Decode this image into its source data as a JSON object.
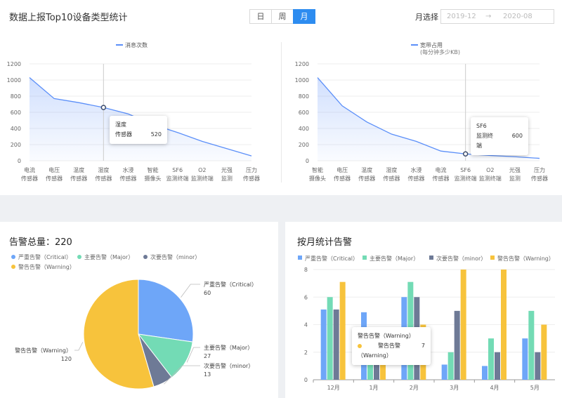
{
  "header": {
    "title": "数据上报Top10设备类型统计",
    "segments": [
      "日",
      "周",
      "月"
    ],
    "active_segment": "月",
    "month_label": "月选择",
    "date_start": "2019-12",
    "date_arrow": "→",
    "date_end": "2020-08"
  },
  "colors": {
    "line": "#5b8ff9",
    "critical": "#6ea6f8",
    "major": "#73dbb5",
    "minor": "#6e7a96",
    "warning": "#f7c33c"
  },
  "chart_data": [
    {
      "type": "area",
      "legend": "消息次数",
      "categories": [
        [
          "电流",
          "传感器"
        ],
        [
          "电压",
          "传感器"
        ],
        [
          "温度",
          "传感器"
        ],
        [
          "湿度",
          "传感器"
        ],
        [
          "水浸",
          "传感器"
        ],
        [
          "智能",
          "摄像头"
        ],
        [
          "SF6",
          "监测终端"
        ],
        [
          "O2",
          "监测终端"
        ],
        [
          "光强",
          "监测"
        ],
        [
          "压力",
          "传感器"
        ]
      ],
      "values": [
        1030,
        770,
        720,
        660,
        580,
        450,
        350,
        240,
        150,
        60
      ],
      "ylim": [
        0,
        1200
      ],
      "yticks": [
        0,
        200,
        400,
        600,
        800,
        1000,
        1200
      ],
      "tooltip": {
        "title": "湿度",
        "label": "传感器",
        "value": "520"
      }
    },
    {
      "type": "area",
      "legend": "宽带占用",
      "legend_sub": "(每分钟多少KB)",
      "categories": [
        [
          "智能",
          "摄像头"
        ],
        [
          "电压",
          "传感器"
        ],
        [
          "温度",
          "传感器"
        ],
        [
          "湿度",
          "传感器"
        ],
        [
          "水浸",
          "传感器"
        ],
        [
          "电流",
          "传感器"
        ],
        [
          "SF6",
          "监测终端"
        ],
        [
          "O2",
          "监测终端"
        ],
        [
          "光强",
          "监测"
        ],
        [
          "压力",
          "传感器"
        ]
      ],
      "values": [
        1030,
        680,
        480,
        330,
        240,
        120,
        85,
        65,
        50,
        30
      ],
      "ylim": [
        0,
        1200
      ],
      "yticks": [
        0,
        200,
        400,
        600,
        800,
        1000,
        1200
      ],
      "tooltip": {
        "title": "SF6",
        "label": "监测终端",
        "value": "600"
      }
    },
    {
      "type": "pie",
      "title_prefix": "告警总量：",
      "total": "220",
      "legend": [
        "严重告警（Critical）",
        "主要告警（Major）",
        "次要告警（minor）",
        "警告告警（Warning）"
      ],
      "slices": [
        {
          "name": "严重告警（Critical）",
          "value": 60
        },
        {
          "name": "主要告警（Major）",
          "value": 27
        },
        {
          "name": "次要告警（minor）",
          "value": 13
        },
        {
          "name": "警告告警（Warning）",
          "value": 120
        }
      ]
    },
    {
      "type": "bar",
      "title": "按月统计告警",
      "categories": [
        "12月",
        "1月",
        "2月",
        "3月",
        "4月",
        "5月"
      ],
      "series": [
        {
          "name": "严重告警（Critical）",
          "values": [
            5.1,
            4.9,
            6,
            1.1,
            1,
            3
          ]
        },
        {
          "name": "主要告警（Major）",
          "values": [
            6,
            1.2,
            7.1,
            2,
            3,
            5
          ]
        },
        {
          "name": "次要告警（minor）",
          "values": [
            5.1,
            1.8,
            6,
            5,
            2,
            2
          ]
        },
        {
          "name": "警告告警（Warning）",
          "values": [
            7.1,
            1.2,
            4,
            8,
            8,
            4
          ]
        }
      ],
      "ylim": [
        0,
        8
      ],
      "yticks": [
        0,
        2,
        4,
        6,
        8
      ],
      "tooltip": {
        "title": "警告告警（Warning）",
        "label": "警告告警（Warning）",
        "value": "7"
      }
    }
  ]
}
